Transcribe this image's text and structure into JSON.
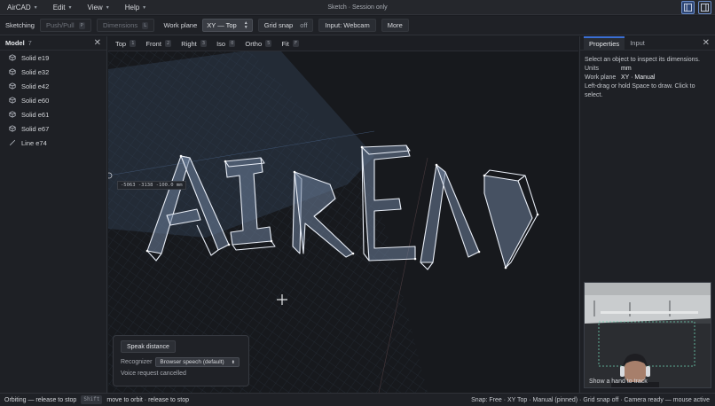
{
  "menubar": {
    "items": [
      {
        "label": "AirCAD"
      },
      {
        "label": "Edit"
      },
      {
        "label": "View"
      },
      {
        "label": "Help"
      }
    ],
    "window_title": "Sketch · Session only"
  },
  "toolbar": {
    "mode_label": "Sketching",
    "push_pull": {
      "label": "Push/Pull",
      "key": "P"
    },
    "dimensions": {
      "label": "Dimensions",
      "key": "L"
    },
    "work_plane_label": "Work plane",
    "work_plane_value": "XY — Top",
    "grid_snap_label": "Grid snap",
    "grid_snap_state": "off",
    "input_label": "Input: Webcam",
    "more_label": "More"
  },
  "model_panel": {
    "title": "Model",
    "count": "7",
    "items": [
      {
        "label": "Solid e19",
        "icon": "cube-icon"
      },
      {
        "label": "Solid e32",
        "icon": "cube-icon"
      },
      {
        "label": "Solid e42",
        "icon": "cube-icon"
      },
      {
        "label": "Solid e60",
        "icon": "cube-icon"
      },
      {
        "label": "Solid e61",
        "icon": "cube-icon"
      },
      {
        "label": "Solid e67",
        "icon": "cube-icon"
      },
      {
        "label": "Line e74",
        "icon": "line-icon"
      }
    ]
  },
  "view_tabs": [
    {
      "label": "Top",
      "key": "1"
    },
    {
      "label": "Front",
      "key": "2"
    },
    {
      "label": "Right",
      "key": "3"
    },
    {
      "label": "Iso",
      "key": "0"
    },
    {
      "label": "Ortho",
      "key": "5"
    },
    {
      "label": "Fit",
      "key": "F"
    }
  ],
  "viewport": {
    "coord_readout": "-5063 -3138 -100.0 mm"
  },
  "voice_panel": {
    "button_label": "Speak distance",
    "recognizer_label": "Recognizer",
    "recognizer_value": "Browser speech (default)",
    "status": "Voice request cancelled"
  },
  "right_panel": {
    "tabs": [
      {
        "label": "Properties"
      },
      {
        "label": "Input"
      }
    ],
    "hint": "Select an object to inspect its dimensions.",
    "units_label": "Units",
    "units_value": "mm",
    "work_plane_label": "Work plane",
    "work_plane_value": "XY · Manual",
    "draw_help": "Left-drag or hold Space to draw. Click to select.",
    "camera_label": "Show a hand to track"
  },
  "statusbar": {
    "mode": "Orbiting — release to stop",
    "key": "Shift",
    "hint": "move to orbit · release to stop",
    "status": "Snap: Free · XY Top · Manual (pinned) · Grid snap off · Camera ready — mouse active"
  },
  "colors": {
    "accent": "#3b6fd4",
    "wire": "#e8edf6",
    "fill": "#7c8ea6"
  }
}
